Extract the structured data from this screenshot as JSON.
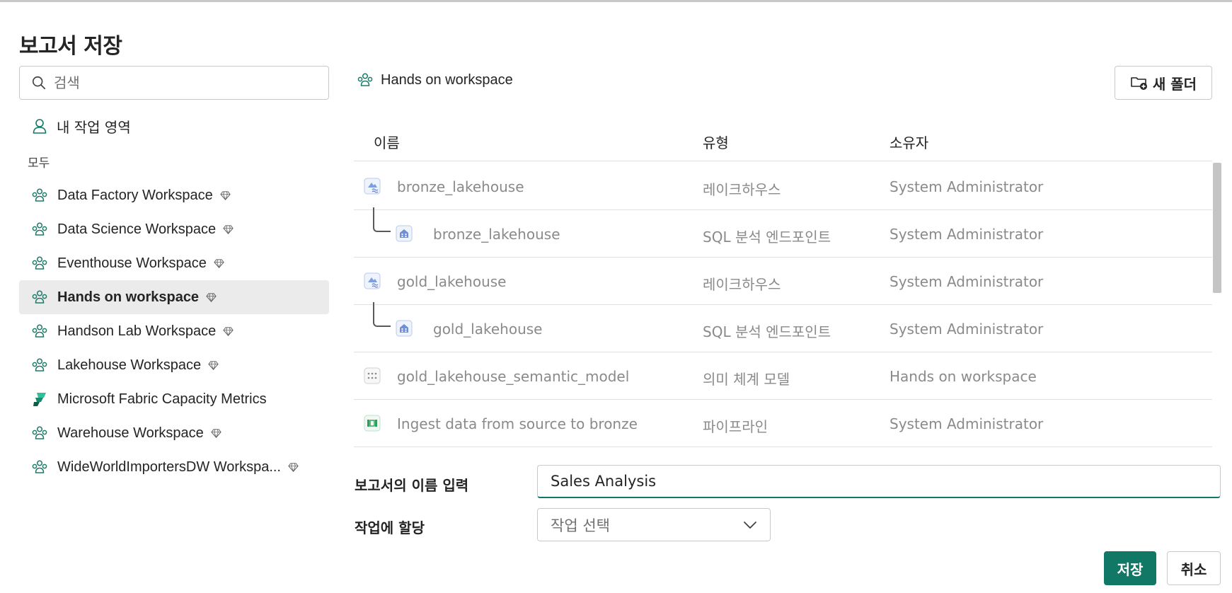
{
  "dialog": {
    "title": "보고서 저장"
  },
  "sidebar": {
    "search_placeholder": "검색",
    "my_workspace": "내 작업 영역",
    "section_all": "모두",
    "workspaces": [
      {
        "label": "Data Factory Workspace",
        "premium": true,
        "icon": "workspace-icon"
      },
      {
        "label": "Data Science Workspace",
        "premium": true,
        "icon": "workspace-icon"
      },
      {
        "label": "Eventhouse Workspace",
        "premium": true,
        "icon": "workspace-icon"
      },
      {
        "label": "Hands on workspace",
        "premium": true,
        "selected": true,
        "icon": "workspace-icon"
      },
      {
        "label": "Handson Lab Workspace",
        "premium": true,
        "icon": "workspace-icon"
      },
      {
        "label": "Lakehouse Workspace",
        "premium": true,
        "icon": "workspace-icon"
      },
      {
        "label": "Microsoft Fabric Capacity Metrics",
        "premium": false,
        "icon": "fabric-icon"
      },
      {
        "label": "Warehouse Workspace",
        "premium": true,
        "icon": "workspace-icon"
      },
      {
        "label": "WideWorldImportersDW Workspa...",
        "premium": true,
        "icon": "workspace-icon"
      }
    ]
  },
  "main": {
    "workspace_title": "Hands on workspace",
    "new_folder_label": "새 폴더",
    "columns": {
      "name": "이름",
      "type": "유형",
      "owner": "소유자"
    },
    "items": [
      {
        "name": "bronze_lakehouse",
        "type": "레이크하우스",
        "owner": "System Administrator",
        "icon": "lakehouse-icon",
        "child": false
      },
      {
        "name": "bronze_lakehouse",
        "type": "SQL 분석 엔드포인트",
        "owner": "System Administrator",
        "icon": "sql-endpoint-icon",
        "child": true
      },
      {
        "name": "gold_lakehouse",
        "type": "레이크하우스",
        "owner": "System Administrator",
        "icon": "lakehouse-icon",
        "child": false
      },
      {
        "name": "gold_lakehouse",
        "type": "SQL 분석 엔드포인트",
        "owner": "System Administrator",
        "icon": "sql-endpoint-icon",
        "child": true
      },
      {
        "name": "gold_lakehouse_semantic_model",
        "type": "의미 체계 모델",
        "owner": "Hands on workspace",
        "icon": "semantic-model-icon",
        "child": false
      },
      {
        "name": "Ingest data from source to bronze",
        "type": "파이프라인",
        "owner": "System Administrator",
        "icon": "pipeline-icon",
        "child": false
      }
    ]
  },
  "form": {
    "report_name_label": "보고서의 이름 입력",
    "report_name_value": "Sales Analysis",
    "assign_label": "작업에 할당",
    "assign_placeholder": "작업 선택"
  },
  "actions": {
    "save": "저장",
    "cancel": "취소"
  },
  "colors": {
    "accent": "#117865",
    "workspace_icon": "#1e7b6b",
    "item_icon": "#6f8fd6"
  }
}
